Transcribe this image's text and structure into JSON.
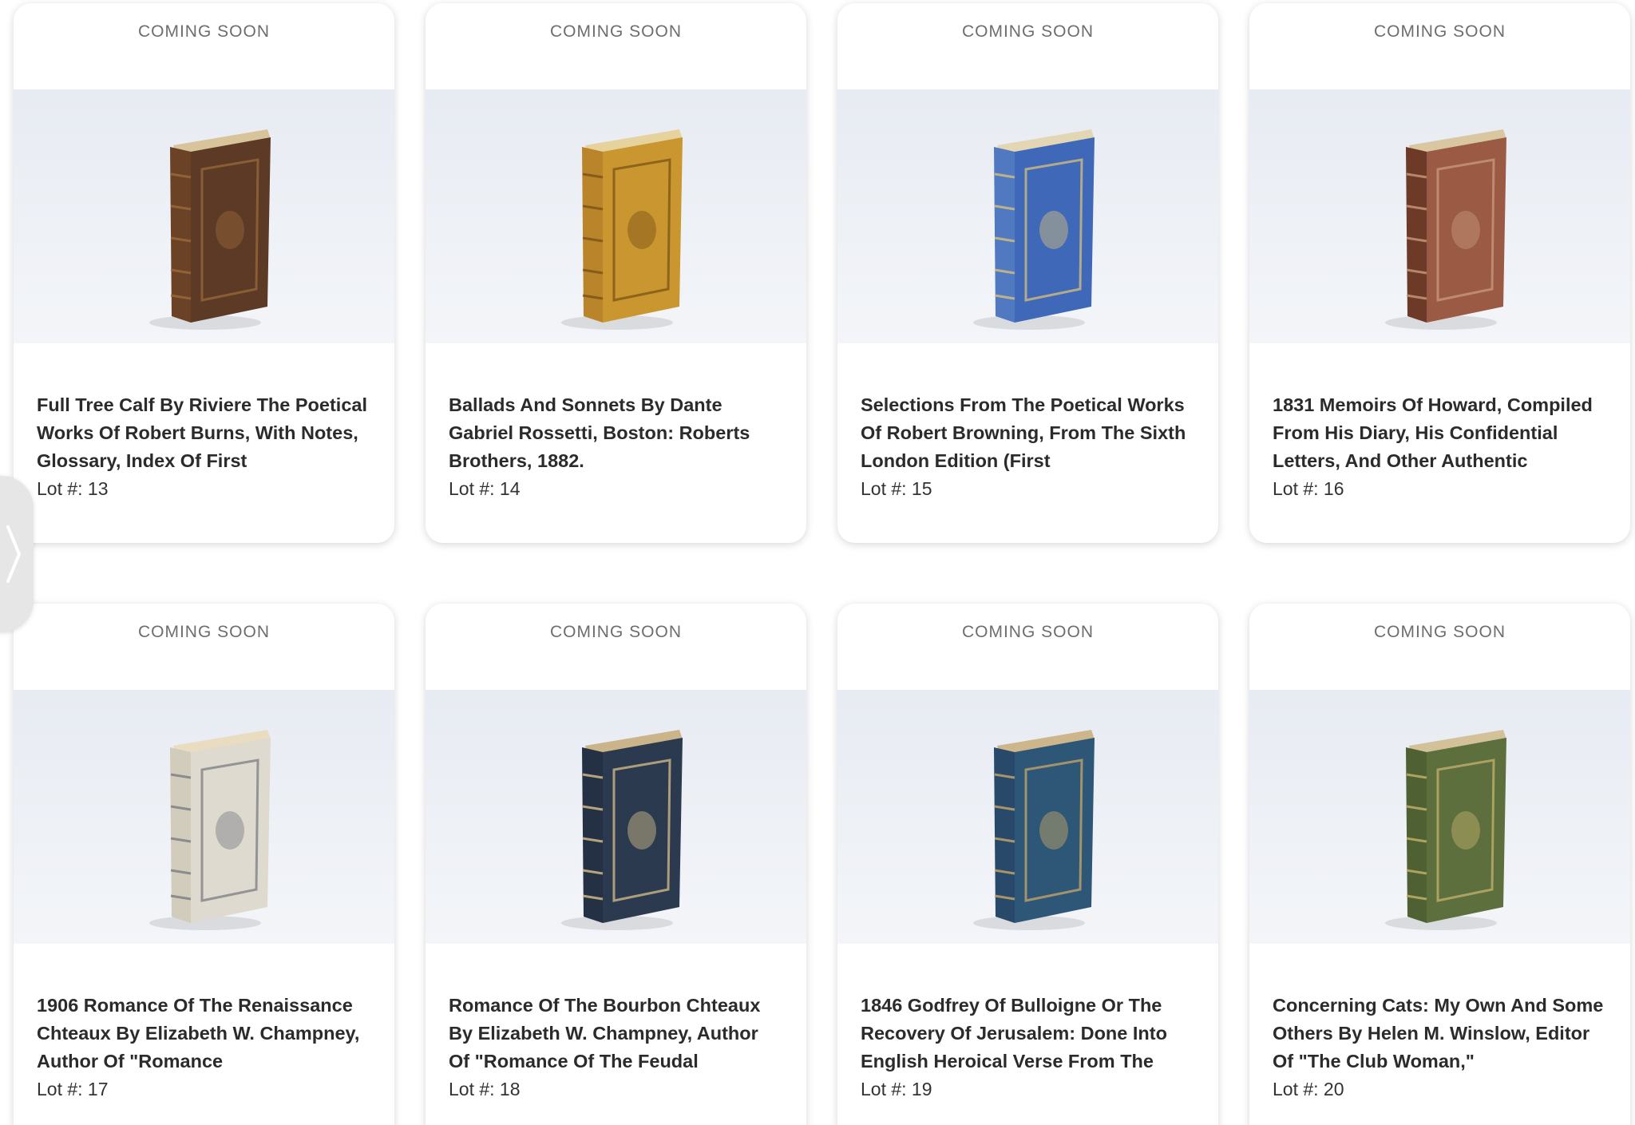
{
  "lots": [
    {
      "status": "COMING SOON",
      "title": "Full Tree Calf By Riviere The Poetical Works Of Robert Burns, With Notes, Glossary, Index Of First",
      "lot_label": "Lot #: 13",
      "book": {
        "cover": "#5c3a26",
        "spine": "#6b4226",
        "top": "#d8c49a",
        "accent": "#9a6a3a"
      }
    },
    {
      "status": "COMING SOON",
      "title": "Ballads And Sonnets By Dante Gabriel Rossetti, Boston: Roberts Brothers, 1882.",
      "lot_label": "Lot #: 14",
      "book": {
        "cover": "#c9962f",
        "spine": "#b9842a",
        "top": "#e6d29d",
        "accent": "#7a5318"
      }
    },
    {
      "status": "COMING SOON",
      "title": "Selections From The Poetical Works Of Robert Browning, From The Sixth London Edition (First",
      "lot_label": "Lot #: 15",
      "book": {
        "cover": "#3f68b8",
        "spine": "#5079c2",
        "top": "#e3d6b4",
        "accent": "#d9c07a"
      }
    },
    {
      "status": "COMING SOON",
      "title": "1831 Memoirs Of Howard, Compiled From His Diary, His Confidential Letters, And Other Authentic",
      "lot_label": "Lot #: 16",
      "book": {
        "cover": "#9a5a44",
        "spine": "#6e3a28",
        "top": "#d9c7a2",
        "accent": "#c99c7c"
      }
    },
    {
      "status": "COMING SOON",
      "title": "1906 Romance Of The Renaissance Chteaux By Elizabeth W. Champney, Author Of \"Romance",
      "lot_label": "Lot #: 17",
      "book": {
        "cover": "#dedad0",
        "spine": "#d2ccbd",
        "top": "#e9dcc0",
        "accent": "#7b7b82"
      }
    },
    {
      "status": "COMING SOON",
      "title": "Romance Of The Bourbon Chteaux By Elizabeth W. Champney, Author Of \"Romance Of The Feudal",
      "lot_label": "Lot #: 18",
      "book": {
        "cover": "#2c3a50",
        "spine": "#243044",
        "top": "#cbb48a",
        "accent": "#d8c08a"
      }
    },
    {
      "status": "COMING SOON",
      "title": "1846 Godfrey Of Bulloigne Or The Recovery Of Jerusalem: Done Into English Heroical Verse From The",
      "lot_label": "Lot #: 19",
      "book": {
        "cover": "#2e5677",
        "spine": "#28496a",
        "top": "#cdb58c",
        "accent": "#c9a865"
      }
    },
    {
      "status": "COMING SOON",
      "title": "Concerning Cats: My Own And Some Others By Helen M. Winslow, Editor Of \"The Club Woman,\"",
      "lot_label": "Lot #: 20",
      "book": {
        "cover": "#5c6f3c",
        "spine": "#4f6133",
        "top": "#d3c199",
        "accent": "#c7b26c"
      }
    }
  ],
  "side_panel": {
    "icon": "chevron-right-icon"
  }
}
